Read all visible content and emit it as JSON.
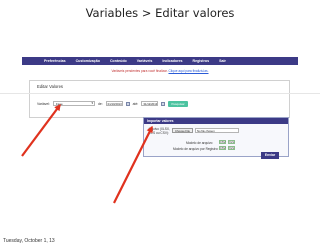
{
  "slide": {
    "title": "Variables > Editar valores",
    "footer": "Tuesday, October 1, 13"
  },
  "nav": {
    "items": [
      "Preferências",
      "Customização",
      "Conteúdo",
      "Variáveis",
      "Indicadores",
      "Registros",
      "Sair"
    ]
  },
  "notice": {
    "text": "Variáveis pendentes para você finalizar.",
    "link": "Clique aqui para finalizá-las."
  },
  "panel": {
    "title": "Editar Valores"
  },
  "filters": {
    "variable_label": "Variável:",
    "variable_value": "Fase",
    "from_label": "de:",
    "from_date": "01/10/2013",
    "until_label": "até:",
    "until_date": "31/12/2013",
    "submit_label": "Pesquisar"
  },
  "import": {
    "title": "Importar valores",
    "file_label": "Arquivo (XLSX, XLS ou CSV):",
    "choose_label": "Choose File",
    "file_status": "No file chosen",
    "row1_label": "Modelo de arquivo:",
    "row1_a": "CSV",
    "row1_b": "XLS",
    "row2_label": "Modelo de arquivo por Registro:",
    "row2_a": "CSV",
    "row2_b": "XLS",
    "submit_label": "Enviar"
  },
  "colors": {
    "nav_bg": "#3c3a86",
    "arrow": "#e0321e",
    "notice": "#c03030",
    "green_button": "#4cc3a0"
  }
}
